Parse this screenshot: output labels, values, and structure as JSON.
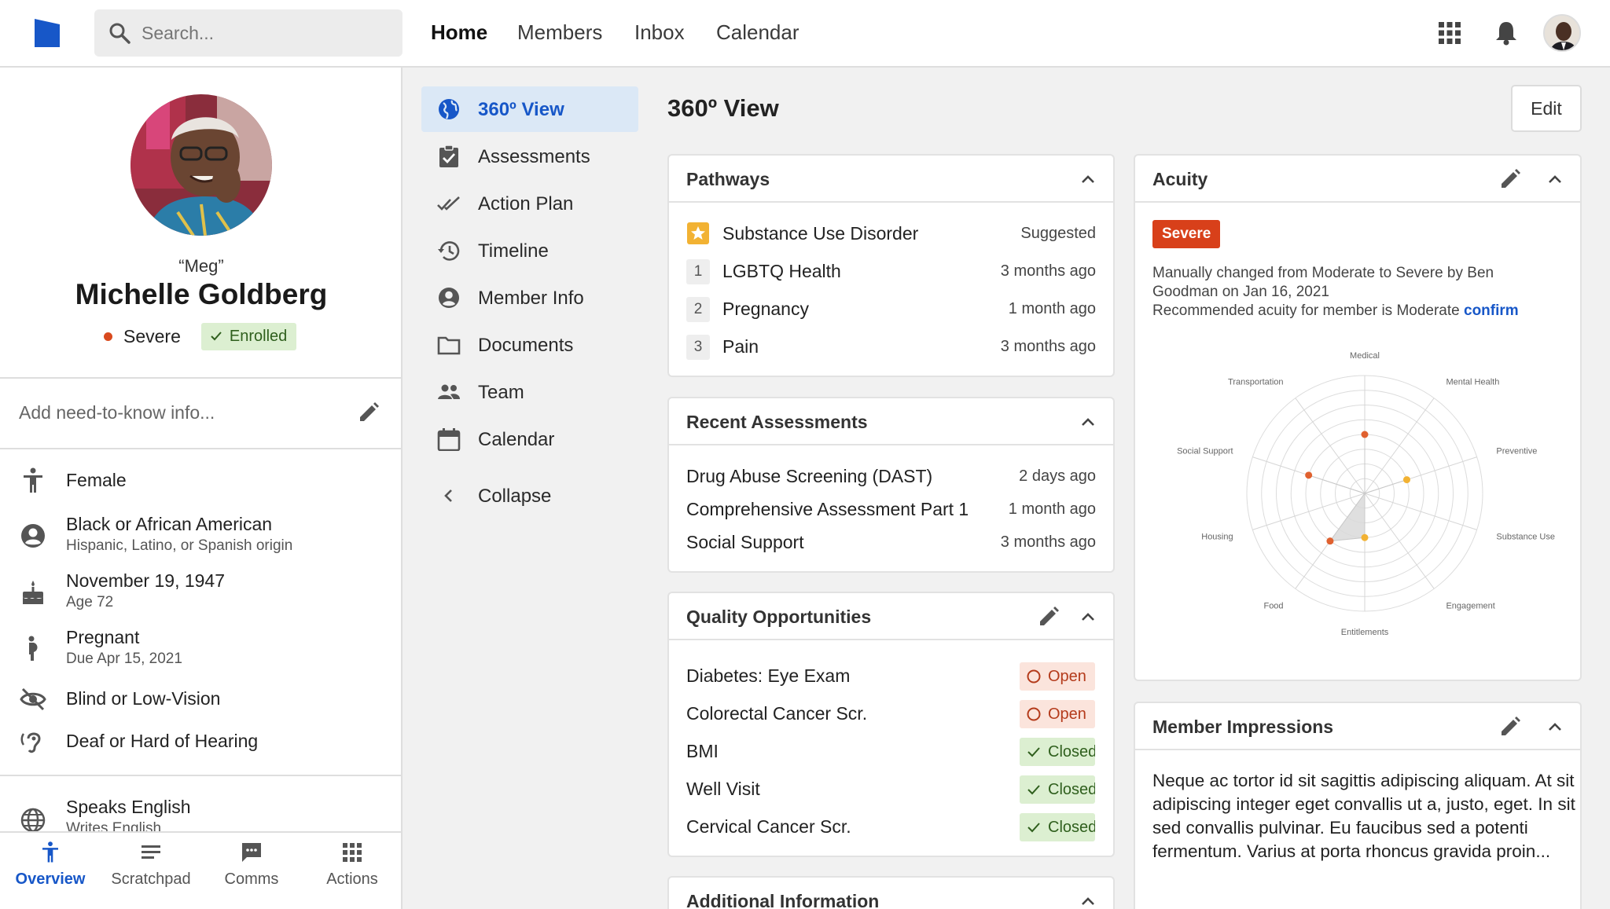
{
  "header": {
    "search_placeholder": "Search...",
    "tabs": [
      {
        "label": "Home",
        "active": true
      },
      {
        "label": "Members",
        "active": false
      },
      {
        "label": "Inbox",
        "active": false
      },
      {
        "label": "Calendar",
        "active": false
      }
    ],
    "brand_color": "#1757c8"
  },
  "profile": {
    "nickname": "“Meg”",
    "name": "Michelle Goldberg",
    "acuity": "Severe",
    "enrollment": "Enrolled",
    "need_to_know_placeholder": "Add need-to-know info...",
    "demographics": [
      {
        "icon": "accessibility-icon",
        "main": "Female",
        "sub": ""
      },
      {
        "icon": "account-circle-icon",
        "main": "Black or African American",
        "sub": "Hispanic, Latino, or Spanish origin"
      },
      {
        "icon": "cake-icon",
        "main": "November 19, 1947",
        "sub": "Age 72"
      },
      {
        "icon": "pregnant-icon",
        "main": "Pregnant",
        "sub": "Due Apr 15, 2021"
      },
      {
        "icon": "eye-off-icon",
        "main": "Blind or Low-Vision",
        "sub": ""
      },
      {
        "icon": "hearing-icon",
        "main": "Deaf or Hard of Hearing",
        "sub": ""
      },
      {
        "icon": "globe-icon",
        "main": "Speaks English",
        "sub": "Writes English"
      }
    ]
  },
  "bottom_tabs": [
    {
      "label": "Overview",
      "active": true
    },
    {
      "label": "Scratchpad",
      "active": false
    },
    {
      "label": "Comms",
      "active": false
    },
    {
      "label": "Actions",
      "active": false
    }
  ],
  "section_nav": [
    {
      "label": "360º View",
      "icon": "globe-icon",
      "active": true
    },
    {
      "label": "Assessments",
      "icon": "clipboard-check-icon",
      "active": false
    },
    {
      "label": "Action Plan",
      "icon": "double-check-icon",
      "active": false
    },
    {
      "label": "Timeline",
      "icon": "history-icon",
      "active": false
    },
    {
      "label": "Member Info",
      "icon": "account-circle-icon",
      "active": false
    },
    {
      "label": "Documents",
      "icon": "folder-icon",
      "active": false
    },
    {
      "label": "Team",
      "icon": "people-icon",
      "active": false
    },
    {
      "label": "Calendar",
      "icon": "calendar-icon",
      "active": false
    },
    {
      "label": "Collapse",
      "icon": "chevron-left-icon",
      "active": false
    }
  ],
  "main": {
    "title": "360º View",
    "edit_label": "Edit",
    "pathways": {
      "title": "Pathways",
      "items": [
        {
          "badge": "star",
          "label": "Substance Use Disorder",
          "time": "Suggested"
        },
        {
          "badge": "1",
          "label": "LGBTQ Health",
          "time": "3 months ago"
        },
        {
          "badge": "2",
          "label": "Pregnancy",
          "time": "1 month ago"
        },
        {
          "badge": "3",
          "label": "Pain",
          "time": "3 months ago"
        }
      ]
    },
    "recent_assessments": {
      "title": "Recent Assessments",
      "items": [
        {
          "label": "Drug Abuse Screening (DAST)",
          "time": "2 days ago"
        },
        {
          "label": "Comprehensive Assessment Part 1",
          "time": "1 month ago"
        },
        {
          "label": "Social Support",
          "time": "3 months ago"
        }
      ]
    },
    "quality_opportunities": {
      "title": "Quality Opportunities",
      "items": [
        {
          "label": "Diabetes: Eye Exam",
          "status": "Open"
        },
        {
          "label": "Colorectal Cancer Scr.",
          "status": "Open"
        },
        {
          "label": "BMI",
          "status": "Closed"
        },
        {
          "label": "Well Visit",
          "status": "Closed"
        },
        {
          "label": "Cervical Cancer Scr.",
          "status": "Closed"
        }
      ]
    },
    "additional_information": {
      "title": "Additional Information"
    },
    "acuity": {
      "title": "Acuity",
      "level": "Severe",
      "text": "Manually changed from Moderate to Severe by Ben Goodman on Jan 16, 2021",
      "recommended": "Recommended acuity for member is Moderate",
      "confirm_label": "confirm"
    },
    "member_impressions": {
      "title": "Member Impressions",
      "text": "Neque ac tortor id sit sagittis adipiscing aliquam. At sit adipiscing integer eget convallis ut a, justo, eget. In sit sed convallis pulvinar. Eu faucibus sed a potenti fermentum. Varius at porta rhoncus gravida proin..."
    }
  },
  "chart_data": {
    "type": "radar",
    "categories": [
      "Medical",
      "Mental Health",
      "Preventive",
      "Substance Use",
      "Engagement",
      "Entitlements",
      "Food",
      "Housing",
      "Social Support",
      "Transportation"
    ],
    "values": [
      4,
      0,
      3,
      0,
      0,
      3,
      4,
      0,
      4,
      0
    ],
    "rmax": 8,
    "rings": 8,
    "highlight_colors": {
      "Medical": "#e0612f",
      "Preventive": "#f2b233",
      "Entitlements": "#f2b233",
      "Food": "#e0612f",
      "Social Support": "#e0612f"
    },
    "fill_color": "#d9d9d9"
  }
}
